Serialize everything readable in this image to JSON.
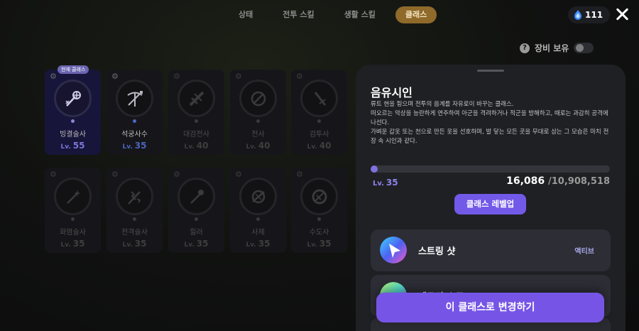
{
  "tabs": [
    {
      "label": "상태",
      "active": false
    },
    {
      "label": "전투 스킬",
      "active": false
    },
    {
      "label": "생활 스킬",
      "active": false
    },
    {
      "label": "클래스",
      "active": true
    }
  ],
  "currency": {
    "icon": "blue-gem-icon",
    "value": "111"
  },
  "equip_keep": {
    "label": "장비 보유",
    "enabled": false
  },
  "current_badge": "현재 클래스",
  "level_prefix": "Lv.",
  "classes": [
    {
      "name": "빙결술사",
      "level": "55",
      "state": "current",
      "icon": "frost-staff-icon"
    },
    {
      "name": "석궁사수",
      "level": "35",
      "state": "owned",
      "icon": "crossbow-icon"
    },
    {
      "name": "대검전사",
      "level": "40",
      "state": "locked",
      "icon": "greatsword-icon"
    },
    {
      "name": "전사",
      "level": "40",
      "state": "locked",
      "icon": "shield-icon"
    },
    {
      "name": "검투사",
      "level": "40",
      "state": "locked",
      "icon": "sword-icon"
    },
    {
      "name": "화염술사",
      "level": "35",
      "state": "locked",
      "icon": "fire-wand-icon"
    },
    {
      "name": "전격술사",
      "level": "35",
      "state": "locked",
      "icon": "lightning-staff-icon"
    },
    {
      "name": "힐러",
      "level": "35",
      "state": "locked",
      "icon": "healer-staff-icon"
    },
    {
      "name": "사제",
      "level": "35",
      "state": "locked",
      "icon": "priest-icon"
    },
    {
      "name": "수도사",
      "level": "35",
      "state": "locked",
      "icon": "monk-icon"
    }
  ],
  "detail": {
    "title": "음유시인",
    "description": [
      "류트 현을 튕으며 전투의 음계를 자유로이 바꾸는 클래스.",
      "떠오르는 악상을 능란하게 연주하여 아군을 격려하거나 적군을 방해하고, 때로는 과감히 공격에 나선다.",
      "가벼운 갑옷 또는 천으로 만든 옷을 선호하며, 발 닿는 모든 곳을 무대로 삼는 그 모습은 마치 전장 속 시인과 같다."
    ],
    "level": "35",
    "xp_current": "16,086",
    "xp_max": "/10,908,518",
    "progress_fraction": 0.0015,
    "level_up_label": "클래스 레벨업",
    "skills": [
      {
        "name": "스트링 샷",
        "type": "액티브",
        "icon": "string-shot-icon"
      },
      {
        "name": "메로디 스로",
        "type": "액티브",
        "icon": "melody-icon"
      }
    ]
  },
  "change_button": "이 클래스로 변경하기",
  "colors": {
    "accent": "#7655e6",
    "current_class": "#7a76d8",
    "owned_class": "#4a65bf",
    "tab_active": "#8f6a2a"
  }
}
